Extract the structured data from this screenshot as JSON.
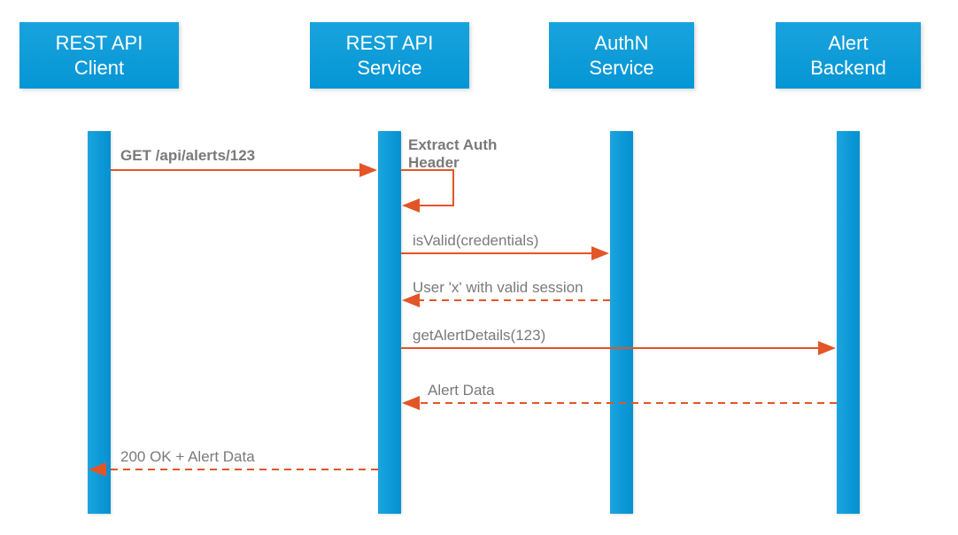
{
  "participants": {
    "p1": {
      "label": "REST API\nClient"
    },
    "p2": {
      "label": "REST API\nService"
    },
    "p3": {
      "label": "AuthN\nService"
    },
    "p4": {
      "label": "Alert\nBackend"
    }
  },
  "messages": {
    "m1": {
      "label": "GET /api/alerts/123"
    },
    "m2": {
      "label": "Extract Auth\nHeader"
    },
    "m3": {
      "label": "isValid(credentials)"
    },
    "m4": {
      "label": "User 'x' with valid session"
    },
    "m5": {
      "label": "getAlertDetails(123)"
    },
    "m6": {
      "label": "Alert Data"
    },
    "m7": {
      "label": "200 OK + Alert Data"
    }
  },
  "colors": {
    "arrow": "#E35527",
    "text": "#7A7A7A"
  }
}
